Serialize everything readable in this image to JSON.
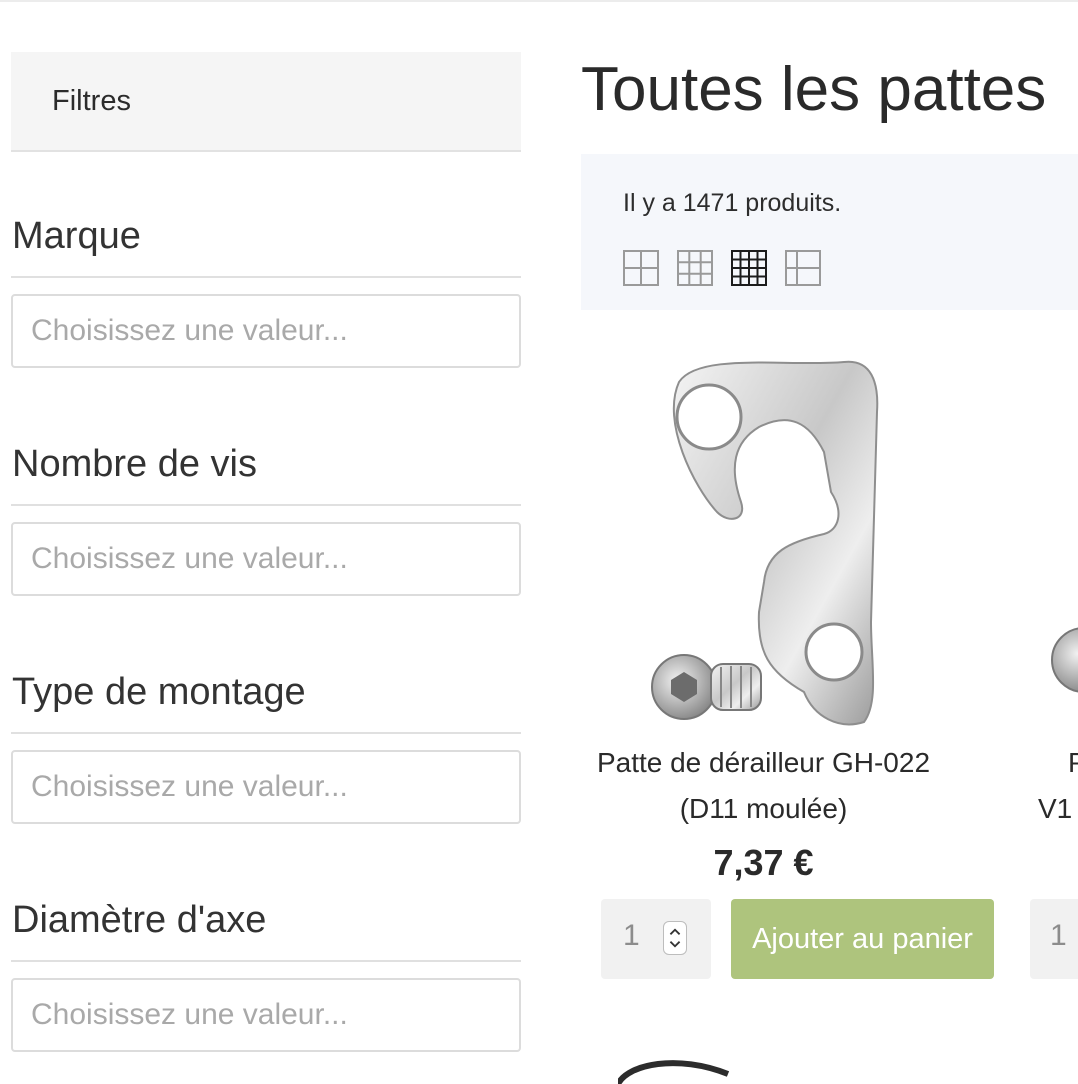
{
  "sidebar": {
    "filters_title": "Filtres",
    "facets": [
      {
        "label": "Marque",
        "placeholder": "Choisissez une valeur..."
      },
      {
        "label": "Nombre de vis",
        "placeholder": "Choisissez une valeur..."
      },
      {
        "label": "Type de montage",
        "placeholder": "Choisissez une valeur..."
      },
      {
        "label": "Diamètre d'axe",
        "placeholder": "Choisissez une valeur..."
      }
    ]
  },
  "main": {
    "title": "Toutes les pattes",
    "product_count_text": "Il y a 1471 produits.",
    "view_modes": [
      {
        "icon": "grid-2-icon",
        "active": false
      },
      {
        "icon": "grid-3-icon",
        "active": false
      },
      {
        "icon": "grid-4-icon",
        "active": true
      },
      {
        "icon": "list-icon",
        "active": false
      }
    ],
    "products": [
      {
        "name": "Patte de dérailleur GH-022 (D11 moulée)",
        "price": "7,37 €",
        "quantity": "1",
        "add_to_cart_label": "Ajouter au panier"
      },
      {
        "name_fragment_line1": "P",
        "name_fragment_line2": "V1",
        "quantity": "1"
      }
    ]
  },
  "colors": {
    "add_to_cart_bg": "#aec47d",
    "toolbar_bg": "#f5f7fb",
    "filters_header_bg": "#f5f5f5"
  }
}
